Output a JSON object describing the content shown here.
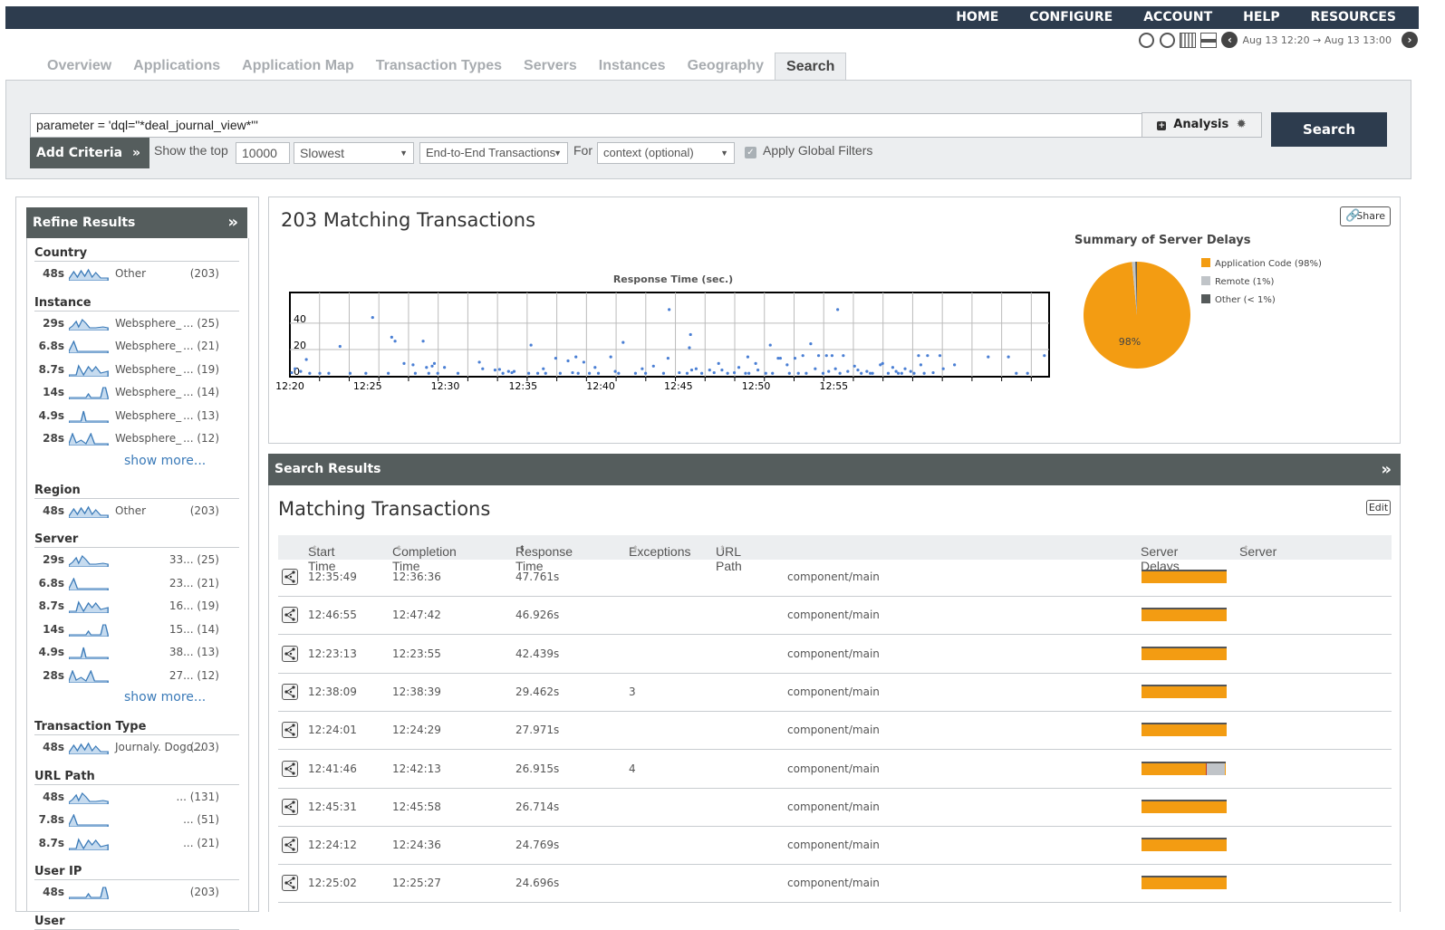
{
  "topnav": [
    "HOME",
    "CONFIGURE",
    "ACCOUNT",
    "HELP",
    "RESOURCES"
  ],
  "timerange": "Aug 13 12:20 → Aug 13 13:00",
  "tabs": [
    "Overview",
    "Applications",
    "Application Map",
    "Transaction Types",
    "Servers",
    "Instances",
    "Geography",
    "Search"
  ],
  "active_tab": "Search",
  "query": {
    "value": "parameter = 'dql=\"*deal_journal_view*\"'",
    "analysis_label": "Analysis",
    "search_label": "Search",
    "add_criteria_label": "Add Criteria",
    "show_top_label": "Show the top",
    "top_count": "10000",
    "order": "Slowest",
    "tx_kind": "End-to-End Transactions",
    "for_label": "For",
    "context_placeholder": "context (optional)",
    "apply_global_filters": "Apply Global Filters",
    "apply_global_filters_checked": true
  },
  "refine": {
    "title": "Refine Results",
    "show_more": "show more...",
    "sections": [
      {
        "title": "Country",
        "items": [
          {
            "val": "48s",
            "label": "Other",
            "count": "(203)"
          }
        ]
      },
      {
        "title": "Instance",
        "items": [
          {
            "val": "29s",
            "label": "Websphere_",
            "count": "... (25)"
          },
          {
            "val": "6.8s",
            "label": "Websphere_",
            "count": "... (21)"
          },
          {
            "val": "8.7s",
            "label": "Websphere_",
            "count": "... (19)"
          },
          {
            "val": "14s",
            "label": "Websphere_",
            "count": "... (14)"
          },
          {
            "val": "4.9s",
            "label": "Websphere_",
            "count": "... (13)"
          },
          {
            "val": "28s",
            "label": "Websphere_",
            "count": "... (12)"
          }
        ]
      },
      {
        "title": "Region",
        "items": [
          {
            "val": "48s",
            "label": "Other",
            "count": "(203)"
          }
        ]
      },
      {
        "title": "Server",
        "items": [
          {
            "val": "29s",
            "label": "",
            "count": "33... (25)"
          },
          {
            "val": "6.8s",
            "label": "",
            "count": "23... (21)"
          },
          {
            "val": "8.7s",
            "label": "",
            "count": "16... (19)"
          },
          {
            "val": "14s",
            "label": "",
            "count": "15... (14)"
          },
          {
            "val": "4.9s",
            "label": "",
            "count": "38... (13)"
          },
          {
            "val": "28s",
            "label": "",
            "count": "27... (12)"
          }
        ]
      },
      {
        "title": "Transaction Type",
        "items": [
          {
            "val": "48s",
            "label": "Journaly. Dogo...",
            "count": "(203)"
          }
        ]
      },
      {
        "title": "URL Path",
        "items": [
          {
            "val": "48s",
            "label": "",
            "count": "... (131)"
          },
          {
            "val": "7.8s",
            "label": "",
            "count": "... (51)"
          },
          {
            "val": "8.7s",
            "label": "",
            "count": "... (21)"
          }
        ]
      },
      {
        "title": "User IP",
        "items": [
          {
            "val": "48s",
            "label": "",
            "count": "(203)"
          }
        ]
      },
      {
        "title": "User",
        "items": []
      }
    ]
  },
  "summary": {
    "title": "203 Matching Transactions",
    "share_label": "Share"
  },
  "chart_data": [
    {
      "type": "scatter",
      "title": "Response Time (sec.)",
      "xlabel": "",
      "ylabel": "",
      "x_ticks": [
        "12:20",
        "12:25",
        "12:30",
        "12:35",
        "12:40",
        "12:45",
        "12:50",
        "12:55"
      ],
      "y_ticks": [
        0,
        20,
        40
      ],
      "xlim_minutes": [
        0,
        40
      ],
      "ylim": [
        0,
        60
      ],
      "grid": true,
      "points_min_sec": [
        [
          0,
          1
        ],
        [
          0.3,
          4
        ],
        [
          0.8,
          2
        ],
        [
          1.3,
          11
        ],
        [
          1.6,
          0.5
        ],
        [
          2.5,
          0.5
        ],
        [
          3.3,
          0.5
        ],
        [
          4.3,
          21
        ],
        [
          5.2,
          0.5
        ],
        [
          6.6,
          0.5
        ],
        [
          7.2,
          43
        ],
        [
          8.6,
          0.5
        ],
        [
          8.9,
          28
        ],
        [
          9.2,
          25
        ],
        [
          10,
          8
        ],
        [
          10.8,
          7
        ],
        [
          11,
          0.5
        ],
        [
          11.7,
          25
        ],
        [
          12,
          5
        ],
        [
          12.2,
          0.5
        ],
        [
          12.5,
          6
        ],
        [
          12.7,
          8
        ],
        [
          13,
          0.5
        ],
        [
          13.6,
          5
        ],
        [
          14.8,
          0.5
        ],
        [
          16.7,
          9
        ],
        [
          17,
          4
        ],
        [
          18.1,
          3
        ],
        [
          18.5,
          3.5
        ],
        [
          18.8,
          0.5
        ],
        [
          19.3,
          2
        ],
        [
          19.6,
          1
        ],
        [
          19.8,
          2
        ],
        [
          21.1,
          0.5
        ],
        [
          21.3,
          22
        ],
        [
          21.9,
          0.5
        ],
        [
          22.4,
          4
        ],
        [
          22.6,
          0.5
        ],
        [
          23.5,
          12
        ],
        [
          23.9,
          0.5
        ],
        [
          24.6,
          10
        ],
        [
          25,
          1
        ],
        [
          25.3,
          13
        ],
        [
          25.5,
          0.5
        ],
        [
          26,
          9
        ],
        [
          26.5,
          0.5
        ],
        [
          27,
          5
        ],
        [
          27.3,
          0.5
        ],
        [
          28.4,
          13
        ],
        [
          28.8,
          2
        ],
        [
          29.1,
          0.5
        ],
        [
          29.5,
          24
        ],
        [
          30.6,
          0.5
        ],
        [
          31.2,
          4
        ],
        [
          31.5,
          0.5
        ],
        [
          32.2,
          6
        ],
        [
          33.1,
          0.5
        ],
        [
          33.5,
          12
        ],
        [
          33.6,
          49
        ],
        [
          34.5,
          1
        ],
        [
          35.2,
          0.5
        ],
        [
          35.4,
          20
        ],
        [
          35.5,
          30
        ],
        [
          35.6,
          3
        ],
        [
          36,
          4
        ],
        [
          36.5,
          0.5
        ],
        [
          37.2,
          3
        ],
        [
          37.6,
          1
        ],
        [
          38,
          8
        ],
        [
          38.3,
          3
        ],
        [
          38.8,
          0.5
        ],
        [
          39.4,
          1
        ],
        [
          39.8,
          5
        ],
        [
          40.4,
          0.5
        ],
        [
          40.6,
          13
        ],
        [
          40.7,
          0.5
        ],
        [
          41.3,
          8
        ],
        [
          41.5,
          3
        ],
        [
          42.2,
          0.5
        ],
        [
          42.6,
          22
        ],
        [
          42.8,
          0.5
        ],
        [
          43.3,
          12
        ],
        [
          43.5,
          12
        ],
        [
          44.1,
          7
        ],
        [
          44.3,
          0.5
        ],
        [
          44.8,
          12
        ],
        [
          45.1,
          0.5
        ],
        [
          45.5,
          14
        ],
        [
          45.8,
          0.5
        ],
        [
          46.2,
          23
        ],
        [
          46.6,
          4
        ],
        [
          46.9,
          14
        ],
        [
          47.3,
          0.5
        ],
        [
          47.6,
          14
        ],
        [
          47.8,
          2
        ],
        [
          48.1,
          14
        ],
        [
          48.4,
          4
        ],
        [
          48.6,
          49
        ],
        [
          48.8,
          0.5
        ],
        [
          49.1,
          14
        ],
        [
          49.5,
          2
        ],
        [
          50.1,
          6
        ],
        [
          50.4,
          3
        ],
        [
          50.7,
          0.5
        ],
        [
          51.2,
          2
        ],
        [
          51.5,
          0.5
        ],
        [
          51.7,
          0.5
        ],
        [
          52.4,
          7
        ],
        [
          52.6,
          8
        ],
        [
          53.1,
          0.5
        ],
        [
          53.5,
          5
        ],
        [
          53.8,
          2
        ],
        [
          54,
          0.5
        ],
        [
          54.3,
          0.5
        ],
        [
          54.6,
          4
        ],
        [
          55.1,
          2
        ],
        [
          55.4,
          0.5
        ],
        [
          55.8,
          14
        ],
        [
          56,
          7
        ],
        [
          56.3,
          0.5
        ],
        [
          56.6,
          14
        ],
        [
          57.1,
          1
        ],
        [
          57.7,
          14
        ],
        [
          58,
          4
        ],
        [
          59,
          7
        ],
        [
          62,
          13
        ],
        [
          63.8,
          13
        ],
        [
          64.5,
          0.5
        ],
        [
          65.5,
          0.5
        ],
        [
          67,
          14
        ]
      ]
    },
    {
      "type": "pie",
      "title": "Summary of Server Delays",
      "labels": [
        "Application Code (98%)",
        "Remote (1%)",
        "Other (< 1%)"
      ],
      "values": [
        98,
        1,
        0.5
      ],
      "colors": [
        "#f39c12",
        "#c0c4c8",
        "#555a5a"
      ],
      "data_label": "98%",
      "legend": "right"
    }
  ],
  "results": {
    "header": "Search Results",
    "title": "Matching Transactions",
    "edit_label": "Edit",
    "columns": [
      "Start Time",
      "Completion Time",
      "Response Time",
      "Exceptions",
      "URL Path",
      "Server Delays",
      "Server"
    ],
    "rows": [
      {
        "start": "12:35:49",
        "end": "12:36:36",
        "resp": "47.761s",
        "exc": "",
        "url": "component/main",
        "delay_app": 1.0,
        "delay_remote": 0
      },
      {
        "start": "12:46:55",
        "end": "12:47:42",
        "resp": "46.926s",
        "exc": "",
        "url": "component/main",
        "delay_app": 1.0,
        "delay_remote": 0
      },
      {
        "start": "12:23:13",
        "end": "12:23:55",
        "resp": "42.439s",
        "exc": "",
        "url": "component/main",
        "delay_app": 1.0,
        "delay_remote": 0
      },
      {
        "start": "12:38:09",
        "end": "12:38:39",
        "resp": "29.462s",
        "exc": "3",
        "url": "component/main",
        "delay_app": 1.0,
        "delay_remote": 0
      },
      {
        "start": "12:24:01",
        "end": "12:24:29",
        "resp": "27.971s",
        "exc": "",
        "url": "component/main",
        "delay_app": 1.0,
        "delay_remote": 0
      },
      {
        "start": "12:41:46",
        "end": "12:42:13",
        "resp": "26.915s",
        "exc": "4",
        "url": "component/main",
        "delay_app": 0.76,
        "delay_remote": 0.23
      },
      {
        "start": "12:45:31",
        "end": "12:45:58",
        "resp": "26.714s",
        "exc": "",
        "url": "component/main",
        "delay_app": 1.0,
        "delay_remote": 0
      },
      {
        "start": "12:24:12",
        "end": "12:24:36",
        "resp": "24.769s",
        "exc": "",
        "url": "component/main",
        "delay_app": 1.0,
        "delay_remote": 0
      },
      {
        "start": "12:25:02",
        "end": "12:25:27",
        "resp": "24.696s",
        "exc": "",
        "url": "component/main",
        "delay_app": 1.0,
        "delay_remote": 0
      }
    ]
  }
}
